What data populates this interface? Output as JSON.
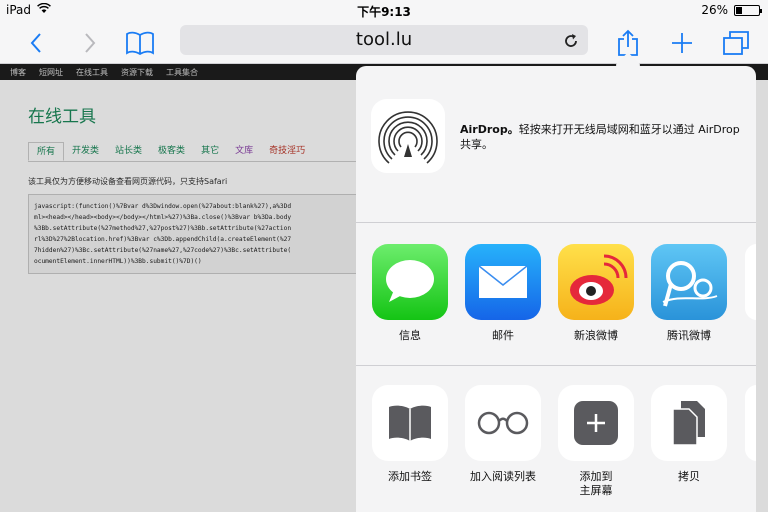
{
  "status": {
    "device": "iPad",
    "time": "下午9:13",
    "battery_text": "26%",
    "battery_level": 0.26
  },
  "toolbar": {
    "url": "tool.lu"
  },
  "webpage": {
    "nav": [
      "博客",
      "短网址",
      "在线工具",
      "资源下载",
      "工具集合"
    ],
    "title": "在线工具",
    "tabs": [
      "所有",
      "开发类",
      "站长类",
      "极客类",
      "其它",
      "文库",
      "奇技淫巧"
    ],
    "note": "该工具仅为方便移动设备查看网页源代码，只支持Safari",
    "code_lines": [
      "javascript:(function()%7Bvar d%3Dwindow.open(%27about:blank%27),a%3Dd",
      "ml><head></head><body></body></html>%27)%3Ba.close()%3Bvar b%3Da.body",
      "%3Bb.setAttribute(%27method%27,%27post%27)%3Bb.setAttribute(%27action",
      "rl%3D%27%2Blocation.href)%3Bvar c%3Db.appendChild(a.createElement(%27",
      "7hidden%27)%3Bc.setAttribute(%27name%27,%27code%27)%3Bc.setAttribute(",
      "ocumentElement.innerHTML))%3Bb.submit()%7D)()"
    ]
  },
  "share": {
    "airdrop": {
      "title": "AirDrop。",
      "description": "轻按来打开无线局域网和蓝牙以通过 AirDrop 共享。"
    },
    "apps": [
      {
        "label": "信息",
        "icon": "messages-icon"
      },
      {
        "label": "邮件",
        "icon": "mail-icon"
      },
      {
        "label": "新浪微博",
        "icon": "sina-weibo-icon"
      },
      {
        "label": "腾讯微博",
        "icon": "tencent-weibo-icon"
      }
    ],
    "actions": [
      {
        "label": "添加书签",
        "icon": "bookmark-icon"
      },
      {
        "label": "加入阅读列表",
        "icon": "reading-list-icon"
      },
      {
        "label_line1": "添加到",
        "label_line2": "主屏幕",
        "icon": "add-home-icon"
      },
      {
        "label": "拷贝",
        "icon": "copy-icon"
      }
    ]
  },
  "colors": {
    "accent": "#1a7cf4",
    "page_green": "#1b8a5a"
  }
}
